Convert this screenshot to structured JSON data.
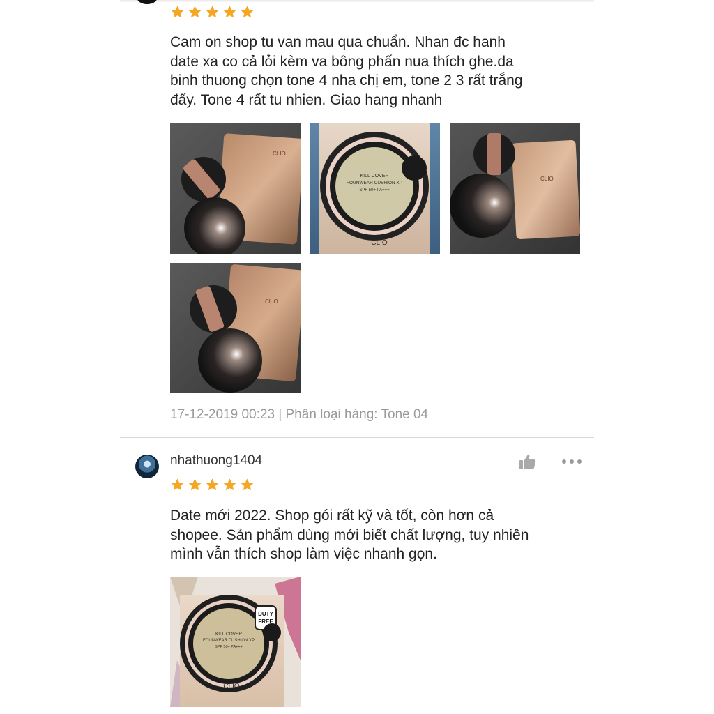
{
  "review1": {
    "rating": 5,
    "text": "Cam on shop tu van mau qua chuẩn. Nhan đc hanh\ndate xa co cả lỏi kèm va bông phấn nua thích ghe.da\nbinh thuong chọn tone 4 nha chị em, tone 2 3 rất trắng\nđấy. Tone 4 rất tu nhien. Giao hang nhanh",
    "photos": [
      {
        "icon": "cushion-refill-photo-icon"
      },
      {
        "icon": "cushion-box-photo-icon",
        "brand": "CLIO",
        "product": "KILL COVER",
        "line": "FOUNWEAR CUSHION XP",
        "spf": "SPF 50+ PA+++"
      },
      {
        "icon": "cushion-refill-photo-icon"
      },
      {
        "icon": "cushion-refill-photo-icon"
      }
    ],
    "meta": "17-12-2019 00:23 | Phân loại hàng: Tone 04"
  },
  "review2": {
    "username": "nhathuong1404",
    "rating": 5,
    "text": "Date mới 2022. Shop gói rất kỹ và tốt, còn hơn cả\nshopee. Sản phẩm dùng mới biết chất lượng, tuy nhiên\nmình vẫn thích shop làm việc nhanh gọn.",
    "photos": [
      {
        "icon": "cushion-box-photo-icon",
        "brand": "CLIO",
        "badge": "DUTY FREE",
        "product": "KILL COVER",
        "line": "FOUNWEAR CUSHION XP",
        "spf": "SPF 50+ PA+++"
      }
    ],
    "like_icon": "thumbs-up-icon",
    "more_icon": "more-dots-icon"
  },
  "colors": {
    "star": "#f5a623",
    "meta": "#9a9a9a",
    "divider": "#d7d7d7"
  }
}
